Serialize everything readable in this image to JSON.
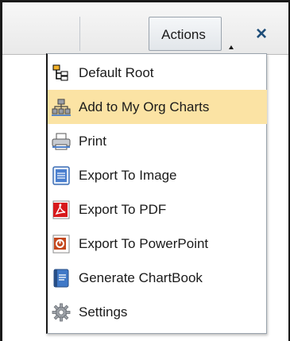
{
  "header": {
    "actions_label": "Actions",
    "close_label": "×"
  },
  "menu": {
    "items": [
      {
        "label": "Default Root",
        "icon": "hierarchy-icon"
      },
      {
        "label": "Add to My Org Charts",
        "icon": "org-chart-icon",
        "highlighted": true
      },
      {
        "label": "Print",
        "icon": "printer-icon"
      },
      {
        "label": "Export To Image",
        "icon": "image-export-icon"
      },
      {
        "label": "Export To PDF",
        "icon": "pdf-icon"
      },
      {
        "label": "Export To PowerPoint",
        "icon": "powerpoint-icon"
      },
      {
        "label": "Generate ChartBook",
        "icon": "chartbook-icon"
      },
      {
        "label": "Settings",
        "icon": "gear-icon"
      }
    ]
  },
  "colors": {
    "highlight": "#fbe3a4",
    "close_icon": "#1f4e79"
  }
}
